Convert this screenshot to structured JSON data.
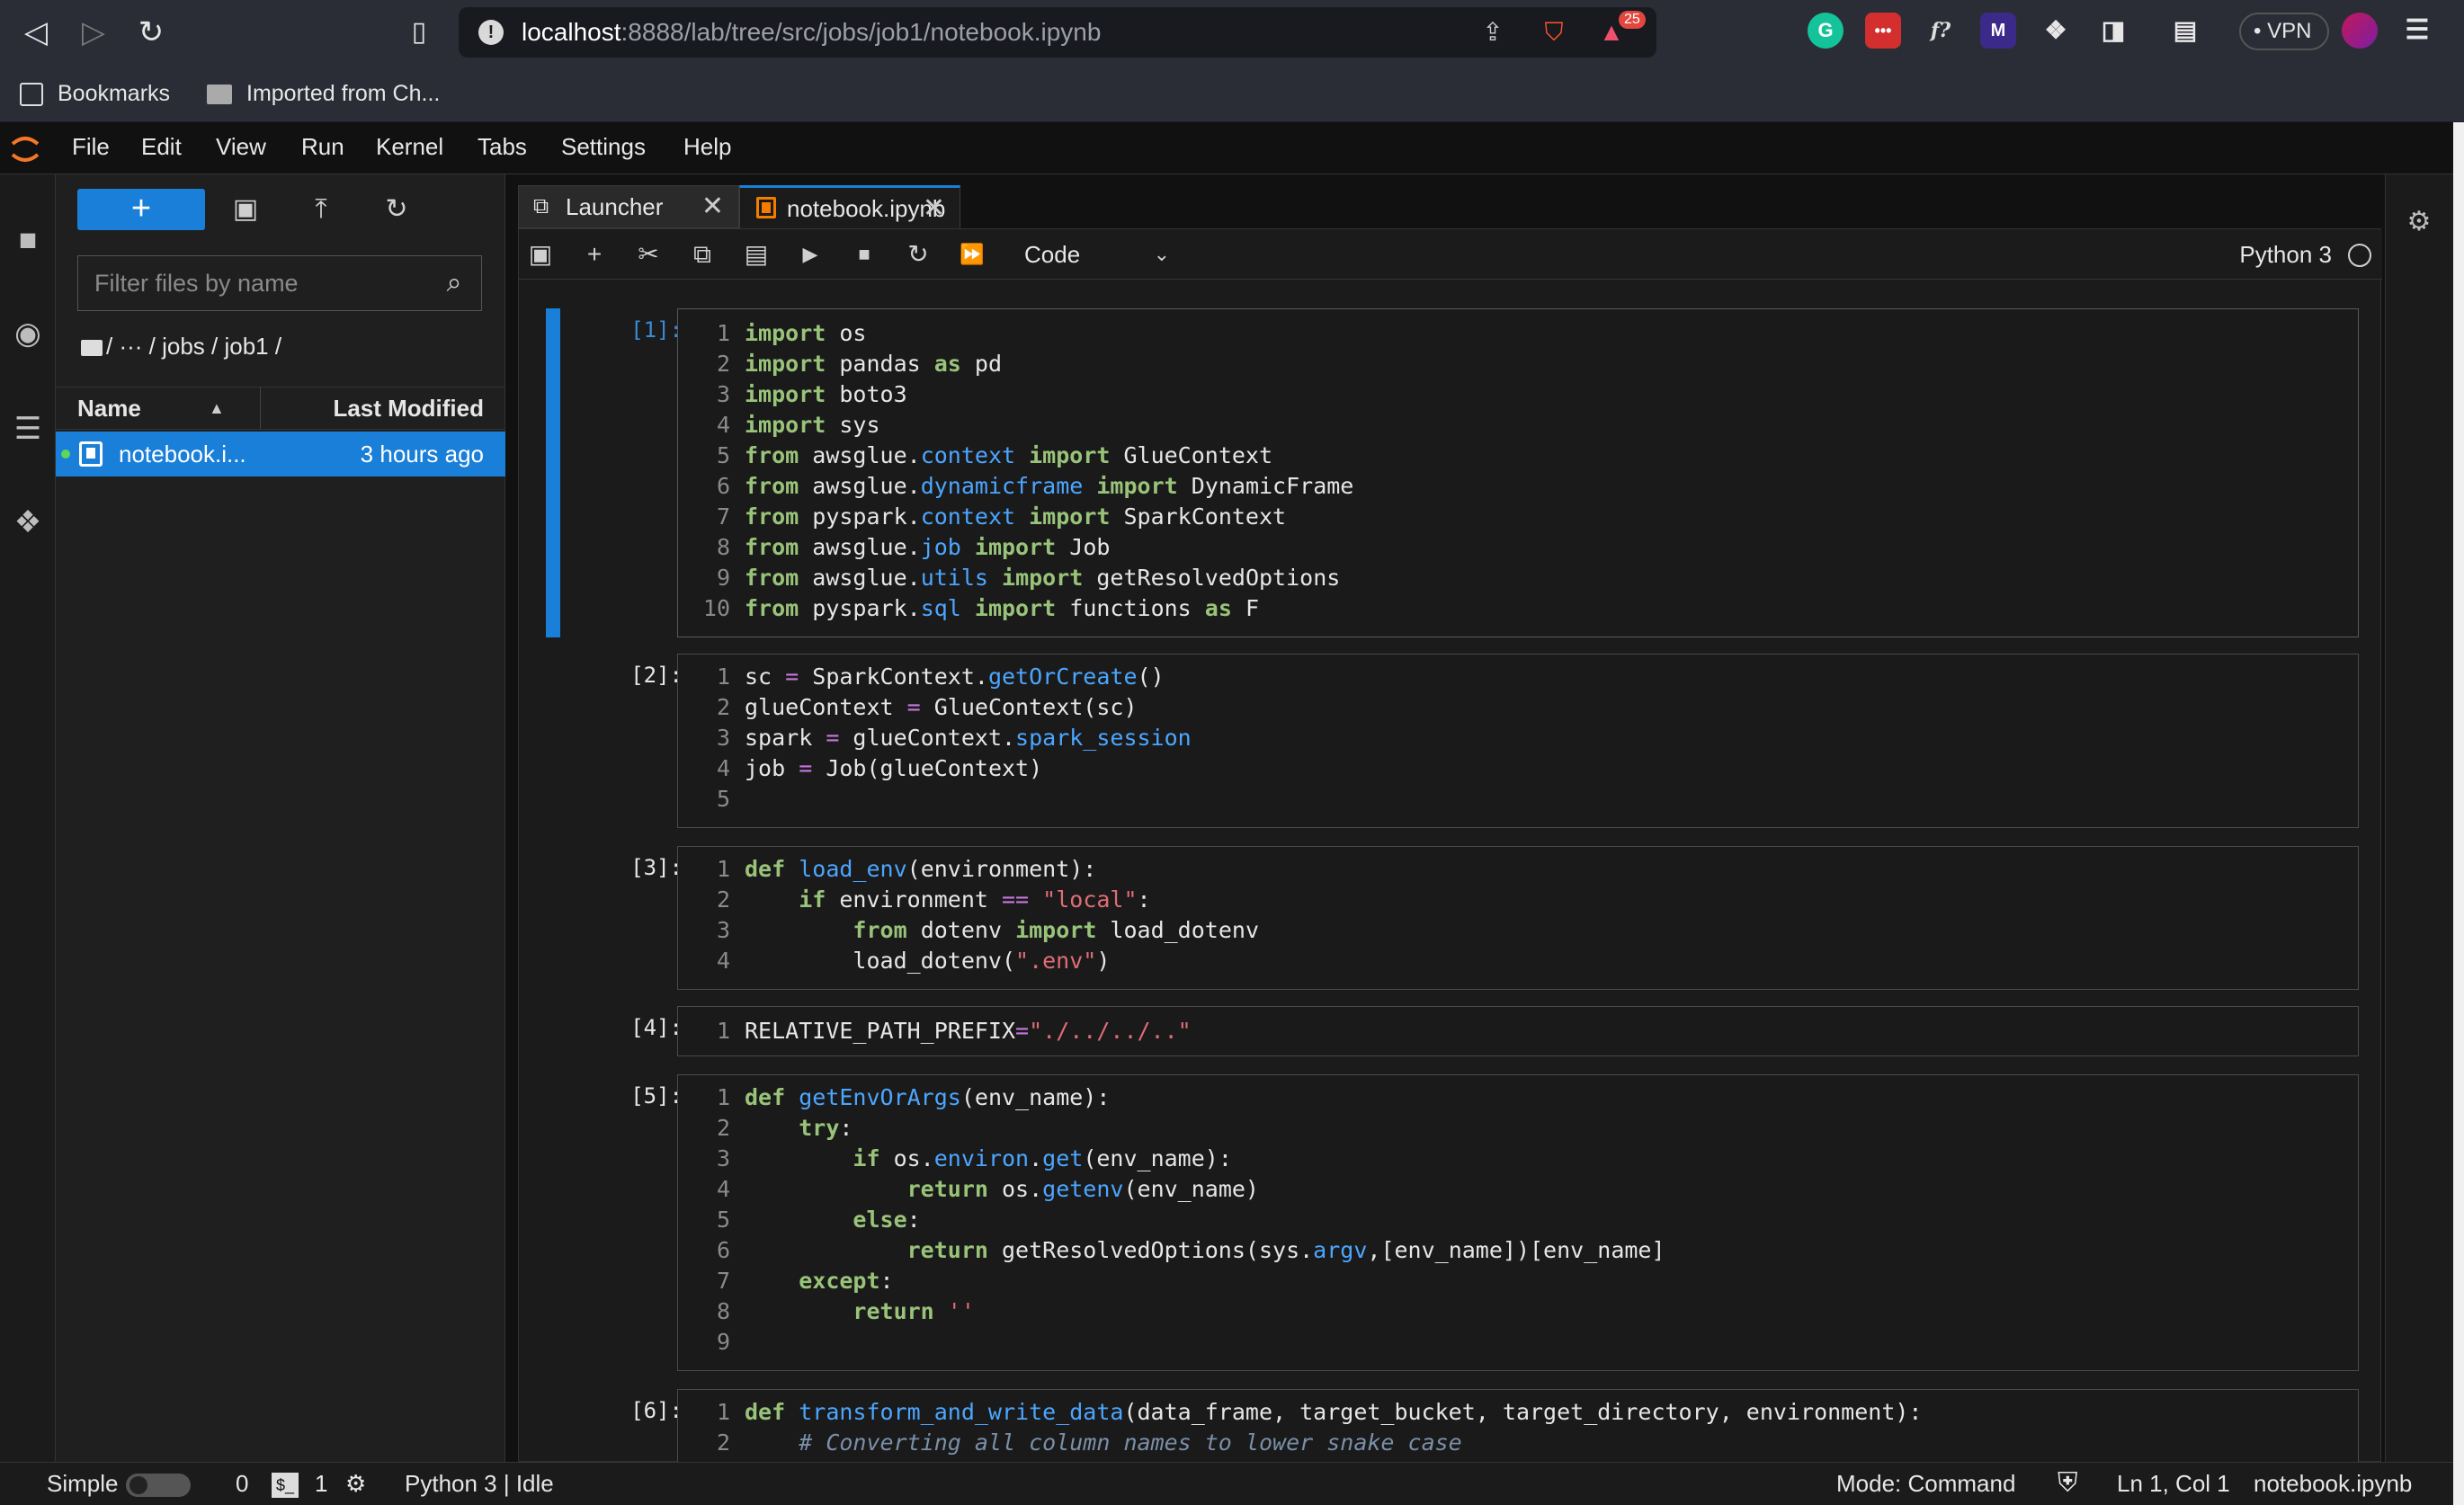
{
  "browser": {
    "url_host": "localhost",
    "url_path": ":8888/lab/tree/src/jobs/job1/notebook.ipynb",
    "brave_badge": "25",
    "vpn_label": "VPN",
    "bookmarks": [
      {
        "label": "Bookmarks"
      },
      {
        "label": "Imported from Ch..."
      }
    ]
  },
  "menu": [
    "File",
    "Edit",
    "View",
    "Run",
    "Kernel",
    "Tabs",
    "Settings",
    "Help"
  ],
  "file_browser": {
    "new_label": "+",
    "filter_placeholder": "Filter files by name",
    "breadcrumb": "/ ··· / jobs / job1 /",
    "col_name": "Name",
    "col_modified": "Last Modified",
    "files": [
      {
        "name": "notebook.i...",
        "modified": "3 hours ago"
      }
    ]
  },
  "tabs": [
    {
      "label": "Launcher",
      "close": "✕"
    },
    {
      "label": "notebook.ipynb",
      "close": "✕"
    }
  ],
  "notebook_toolbar": {
    "cell_type": "Code",
    "kernel": "Python 3"
  },
  "cells": [
    {
      "prompt": "[1]:",
      "lines": [
        "import os",
        "import pandas as pd",
        "import boto3",
        "import sys",
        "from awsglue.context import GlueContext",
        "from awsglue.dynamicframe import DynamicFrame",
        "from pyspark.context import SparkContext",
        "from awsglue.job import Job",
        "from awsglue.utils import getResolvedOptions",
        "from pyspark.sql import functions as F"
      ]
    },
    {
      "prompt": "[2]:",
      "lines": [
        "sc = SparkContext.getOrCreate()",
        "glueContext = GlueContext(sc)",
        "spark = glueContext.spark_session",
        "job = Job(glueContext)",
        ""
      ]
    },
    {
      "prompt": "[3]:",
      "lines": [
        "def load_env(environment):",
        "    if environment == \"local\":",
        "        from dotenv import load_dotenv",
        "        load_dotenv(\".env\")"
      ]
    },
    {
      "prompt": "[4]:",
      "lines": [
        "RELATIVE_PATH_PREFIX=\"./../../..\""
      ]
    },
    {
      "prompt": "[5]:",
      "lines": [
        "def getEnvOrArgs(env_name):",
        "    try:",
        "        if os.environ.get(env_name):",
        "            return os.getenv(env_name)",
        "        else:",
        "            return getResolvedOptions(sys.argv,[env_name])[env_name]",
        "    except:",
        "        return ''",
        ""
      ]
    },
    {
      "prompt": "[6]:",
      "lines": [
        "def transform_and_write_data(data_frame, target_bucket, target_directory, environment):",
        "    # Converting all column names to lower snake case"
      ]
    }
  ],
  "status": {
    "mode_label": "Simple",
    "terminals": "0",
    "kernels": "1",
    "kernel_status": "Python 3 | Idle",
    "command_mode": "Mode: Command",
    "cursor": "Ln 1, Col 1",
    "file": "notebook.ipynb"
  },
  "colors": {
    "accent": "#1a7fd8",
    "keyword": "#c678dd",
    "string": "#e06c75",
    "attribute": "#4ca6ff"
  }
}
